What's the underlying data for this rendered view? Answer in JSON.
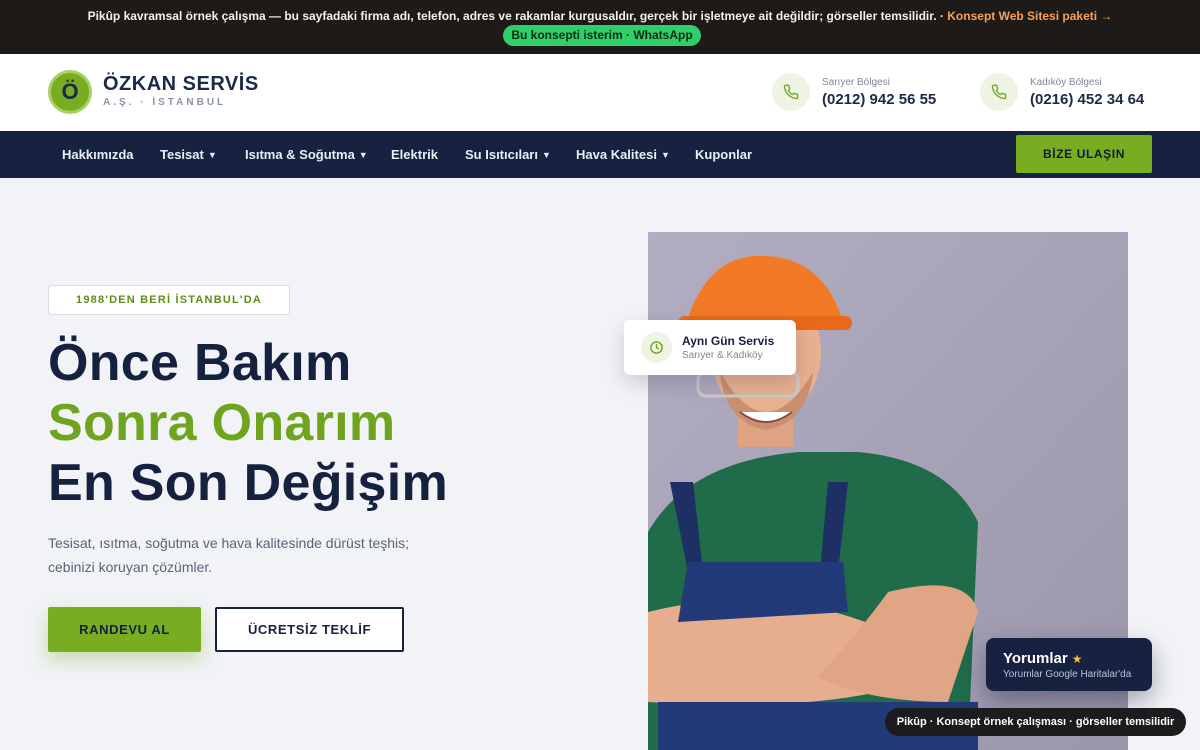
{
  "notice": {
    "text": "Pikûp kavramsal örnek çalışma — bu sayfadaki firma adı, telefon, adres ve rakamlar kurgusaldır, gerçek bir işletmeye ait değildir; görseller temsilidir. · ",
    "link": "Konsept Web Sitesi paketi →",
    "whatsapp_button": "Bu konsepti isterim · WhatsApp"
  },
  "header": {
    "logo_letter": "Ö",
    "brand_name": "ÖZKAN SERVİS",
    "brand_sub": "A.Ş. · İSTANBUL",
    "contacts": [
      {
        "region": "Sarıyer Bölgesi",
        "phone": "(0212) 942 56 55",
        "icon": "phone-icon"
      },
      {
        "region": "Kadıköy Bölgesi",
        "phone": "(0216) 452 34 64",
        "icon": "phone-icon"
      }
    ]
  },
  "nav": {
    "items": [
      {
        "label": "Hakkımızda",
        "dropdown": false
      },
      {
        "label": "Tesisat",
        "dropdown": true
      },
      {
        "label": "Isıtma & Soğutma",
        "dropdown": true
      },
      {
        "label": "Elektrik",
        "dropdown": false
      },
      {
        "label": "Su Isıtıcıları",
        "dropdown": true
      },
      {
        "label": "Hava Kalitesi",
        "dropdown": true
      },
      {
        "label": "Kuponlar",
        "dropdown": false
      }
    ],
    "caret": "▼",
    "cta": "BİZE ULAŞIN"
  },
  "hero": {
    "badge": "1988'DEN BERİ İSTANBUL'DA",
    "line1": "Önce Bakım",
    "line2": "Sonra Onarım",
    "line3": "En Son Değişim",
    "lead_line1": "Tesisat, ısıtma, soğutma ve hava kalitesinde dürüst teşhis;",
    "lead_line2": "cebinizi koruyan çözümler.",
    "primary_button": "RANDEVU AL",
    "secondary_button": "ÜCRETSİZ TEKLİF"
  },
  "float_card": {
    "title": "Aynı Gün Servis",
    "sub": "Sarıyer & Kadıköy",
    "icon": "clock-icon"
  },
  "reviews": {
    "title": "Yorumlar",
    "star": "★",
    "sub": "Yorumlar Google Haritalar'da"
  },
  "footer_pill": "Pikûp · Konsept örnek çalışması · görseller temsilidir",
  "colors": {
    "accent_green": "#78ad22",
    "navy": "#16223f",
    "notice_bg": "#1e1a17",
    "whatsapp_green": "#2fd06a",
    "notice_link": "#f6a05a"
  }
}
